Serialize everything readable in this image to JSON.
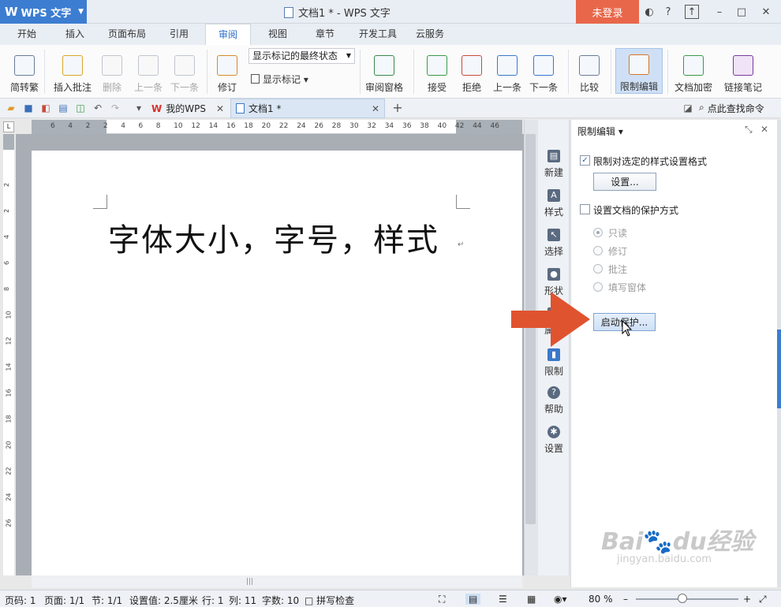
{
  "app": {
    "name": "WPS 文字",
    "window_title": "文档1 * - WPS 文字",
    "login": "未登录"
  },
  "menu_tabs": [
    "开始",
    "插入",
    "页面布局",
    "引用",
    "审阅",
    "视图",
    "章节",
    "开发工具",
    "云服务"
  ],
  "active_tab": "审阅",
  "ribbon": {
    "simp_trad": "简转繁",
    "insert_comment": "插入批注",
    "delete": "删除",
    "prev": "上一条",
    "next": "下一条",
    "revise": "修订",
    "mark_state": "显示标记的最终状态",
    "show_mark": "显示标记",
    "review_pane": "审阅窗格",
    "accept": "接受",
    "reject": "拒绝",
    "prev2": "上一条",
    "next2": "下一条",
    "compare": "比较",
    "restrict_edit": "限制编辑",
    "doc_encrypt": "文档加密",
    "link_note": "链接笔记"
  },
  "doc_tabs": {
    "mywps": "我的WPS",
    "doc1": "文档1 *"
  },
  "find_command": "点此查找命令",
  "ruler": {
    "h": [
      "6",
      "4",
      "2",
      "2",
      "4",
      "6",
      "8",
      "10",
      "12",
      "14",
      "16",
      "18",
      "20",
      "22",
      "24",
      "26",
      "28",
      "30",
      "32",
      "34",
      "36",
      "38",
      "40",
      "42",
      "44",
      "46"
    ],
    "v": [
      "2",
      "2",
      "4",
      "6",
      "8",
      "10",
      "12",
      "14",
      "16",
      "18",
      "20",
      "22",
      "24",
      "26"
    ]
  },
  "document": {
    "text": "字体大小，字号，样式"
  },
  "side_tools": [
    "新建",
    "样式",
    "选择",
    "形状",
    "属性",
    "限制",
    "帮助",
    "设置"
  ],
  "panel": {
    "title": "限制编辑",
    "limit_format": "限制对选定的样式设置格式",
    "settings_btn": "设置...",
    "protect_mode": "设置文档的保护方式",
    "options": [
      "只读",
      "修订",
      "批注",
      "填写窗体"
    ],
    "start_btn": "启动保护..."
  },
  "status": {
    "page": "页码: 1",
    "pages": "页面: 1/1",
    "section": "节: 1/1",
    "setting": "设置值: 2.5厘米",
    "row": "行: 1",
    "col": "列: 11",
    "words": "字数: 10",
    "spell": "拼写检查",
    "zoom": "80 %",
    "zoom_level": 0.45
  },
  "watermark": {
    "logo": "Baidu经验",
    "url": "jingyan.baidu.com"
  },
  "colors": {
    "accent": "#3c7dd1",
    "login": "#e8674a",
    "arrow": "#e0532f"
  }
}
